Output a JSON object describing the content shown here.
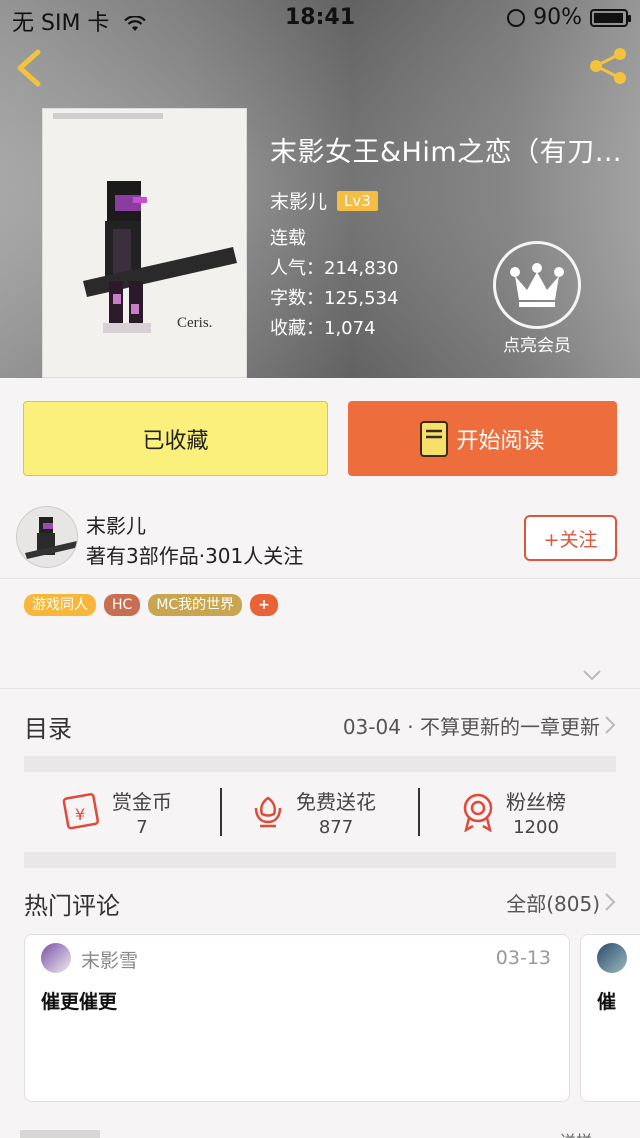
{
  "status_bar": {
    "carrier": "无 SIM 卡",
    "time": "18:41",
    "battery": "90%"
  },
  "book": {
    "title": "末影女王&Him之恋（有刀…",
    "author": "末影儿",
    "level": "Lv3",
    "status": "连载",
    "popularity": "人气：214,830",
    "word_count": "字数：125,534",
    "favorites": "收藏：1,074",
    "cover_signature": "Ceris."
  },
  "member": {
    "label": "点亮会员"
  },
  "actions": {
    "collect_label": "已收藏",
    "read_label": "开始阅读"
  },
  "author_card": {
    "name": "末影儿",
    "stats": "著有3部作品·301人关注",
    "follow_label": "+关注"
  },
  "tags": [
    "游戏同人",
    "HC",
    "MC我的世界",
    "+"
  ],
  "catalog": {
    "label": "目录",
    "latest": "03-04 · 不算更新的一章更新"
  },
  "stats": [
    {
      "label": "赏金币",
      "value": "7",
      "icon": "red-envelope-icon"
    },
    {
      "label": "免费送花",
      "value": "877",
      "icon": "flower-icon"
    },
    {
      "label": "粉丝榜",
      "value": "1200",
      "icon": "medal-icon"
    }
  ],
  "comments": {
    "label": "热门评论",
    "all_label": "全部(805)",
    "items": [
      {
        "user": "末影雪",
        "date": "03-13",
        "text": "催更催更"
      },
      {
        "user": "",
        "date": "",
        "text": "催"
      }
    ]
  },
  "bottom": {
    "right_text": "送样"
  },
  "colors": {
    "accent_orange": "#ee6d3c",
    "collect_yellow": "#fbf07b",
    "follow_red": "#e0553a",
    "level_badge": "#f5bd44"
  }
}
